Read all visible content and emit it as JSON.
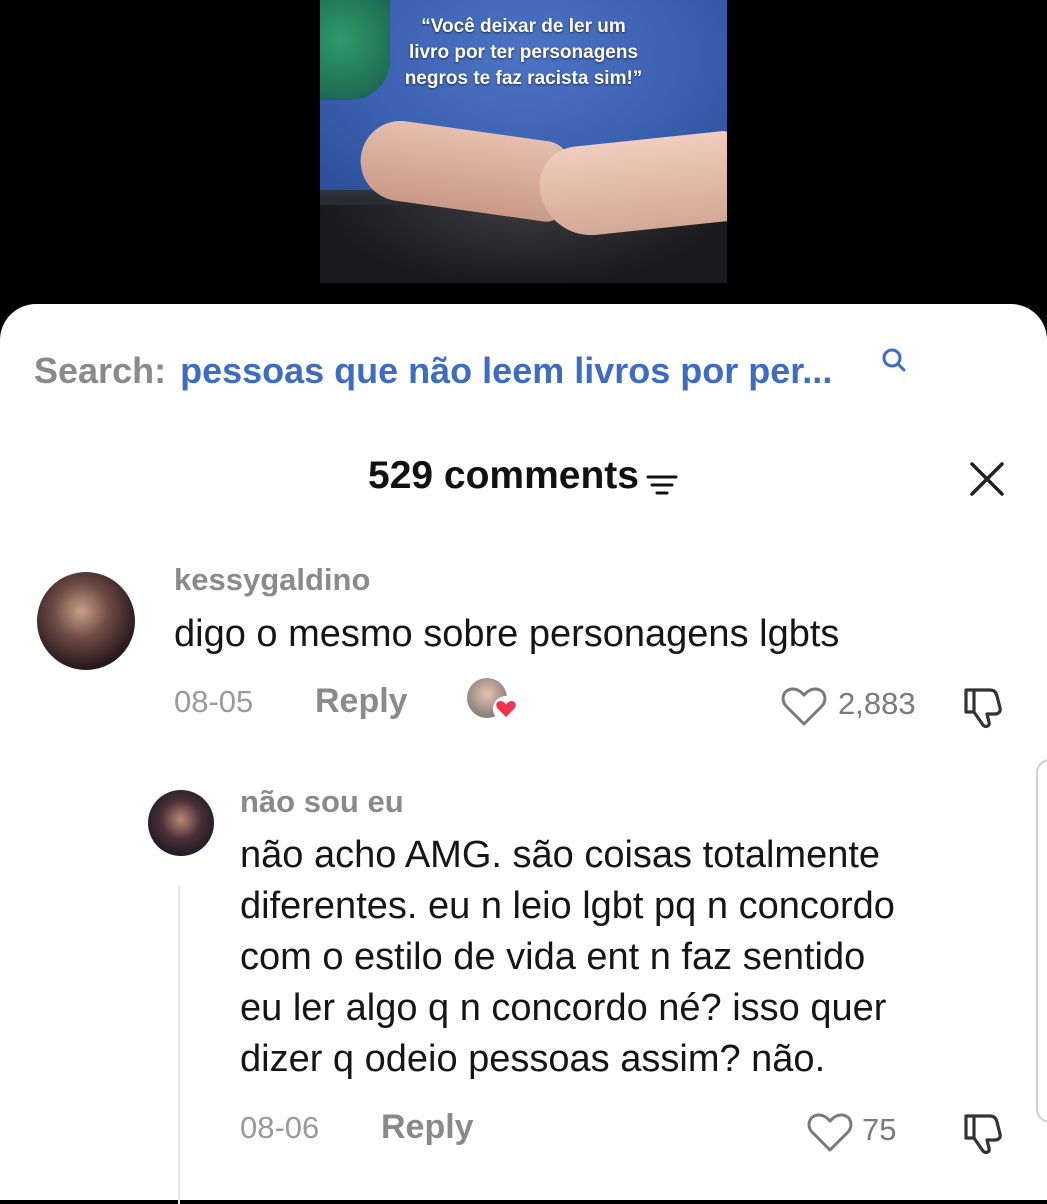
{
  "video": {
    "caption_lines": [
      "“Você deixar de ler um",
      "livro por ter personagens",
      "negros te faz racista sim!”"
    ]
  },
  "search": {
    "prefix": "Search:",
    "query": "pessoas que não leem livros por per...",
    "icon": "search-icon"
  },
  "header": {
    "title": "529 comments",
    "filter_icon": "filter-icon",
    "close_icon": "close-icon"
  },
  "comments": [
    {
      "username": "kessygaldino",
      "text": "digo o mesmo sobre personagens lgbts",
      "date": "08-05",
      "reply_label": "Reply",
      "likes": "2,883",
      "liked_by_creator": true
    }
  ],
  "replies": [
    {
      "username": "não sou eu",
      "text_lines": [
        "não acho AMG. são coisas totalmente",
        "diferentes. eu n leio lgbt pq n concordo",
        "com o estilo de vida ent n faz sentido",
        "eu ler algo q n concordo né? isso quer",
        "dizer q odeio pessoas assim? não."
      ],
      "date": "08-06",
      "reply_label": "Reply",
      "likes": "75"
    }
  ],
  "colors": {
    "accent_blue": "#3d6cc0",
    "heart_red": "#f0344f",
    "muted": "#8a8a8a"
  }
}
